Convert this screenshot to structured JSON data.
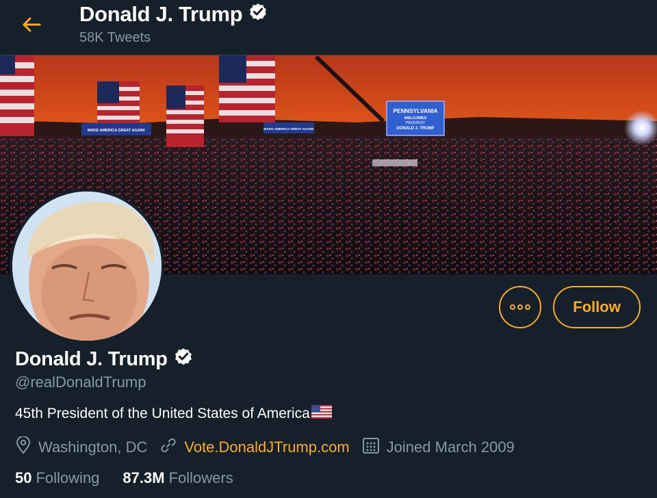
{
  "header": {
    "title": "Donald J. Trump",
    "tweet_count": "58K Tweets"
  },
  "banner": {
    "sign_main_line1": "PENNSYLVANIA",
    "sign_main_line2": "WELCOMES",
    "sign_main_line3": "PRESIDENT",
    "sign_main_line4": "DONALD J. TRUMP",
    "sign_left": "MAKE AMERICA GREAT AGAIN!",
    "sign_mid": "MAKE AMERICA GREAT AGAIN!"
  },
  "actions": {
    "follow_label": "Follow"
  },
  "profile": {
    "name": "Donald J. Trump",
    "handle": "@realDonaldTrump",
    "bio": "45th President of the United States of America",
    "location": "Washington, DC",
    "website": "Vote.DonaldJTrump.com",
    "joined": "Joined March 2009"
  },
  "stats": {
    "following_count": "50",
    "following_label": "Following",
    "followers_count": "87.3M",
    "followers_label": "Followers"
  },
  "colors": {
    "background": "#15202b",
    "accent": "#ffad1f",
    "secondary_text": "#8899a6",
    "border": "#38444d"
  },
  "icons": {
    "back": "arrow-left-icon",
    "verified": "verified-badge-icon",
    "more": "more-horizontal-icon",
    "location": "location-pin-icon",
    "link": "link-icon",
    "calendar": "calendar-icon",
    "flag": "us-flag-emoji"
  }
}
